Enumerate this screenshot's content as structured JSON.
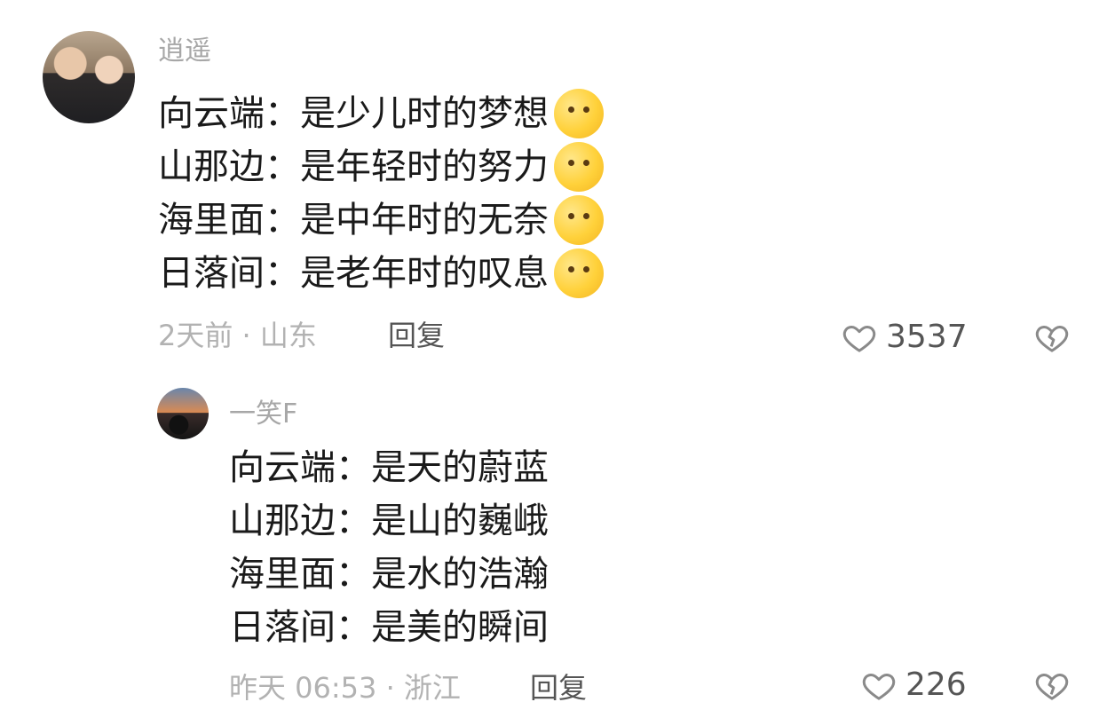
{
  "comments": [
    {
      "username": "逍遥",
      "lines": [
        "向云端：是少儿时的梦想",
        "山那边：是年轻时的努力",
        "海里面：是中年时的无奈",
        "日落间：是老年时的叹息"
      ],
      "emojis": [
        "thinking-emoji",
        "wink-headband-emoji",
        "rolling-eyes-emoji",
        "pleading-emoji"
      ],
      "meta": "2天前 · 山东",
      "reply_label": "回复",
      "like_count": "3537"
    },
    {
      "username": "一笑F",
      "lines": [
        "向云端：是天的蔚蓝",
        "山那边：是山的巍峨",
        "海里面：是水的浩瀚",
        "日落间：是美的瞬间"
      ],
      "meta": "昨天 06:53 · 浙江",
      "reply_label": "回复",
      "like_count": "226"
    }
  ],
  "colors": {
    "username": "#a7a7a7",
    "text": "#1a1a1a",
    "meta": "#b2b2b2",
    "action": "#555555"
  },
  "icons": {
    "like": "heart-icon",
    "dislike": "broken-heart-icon"
  }
}
